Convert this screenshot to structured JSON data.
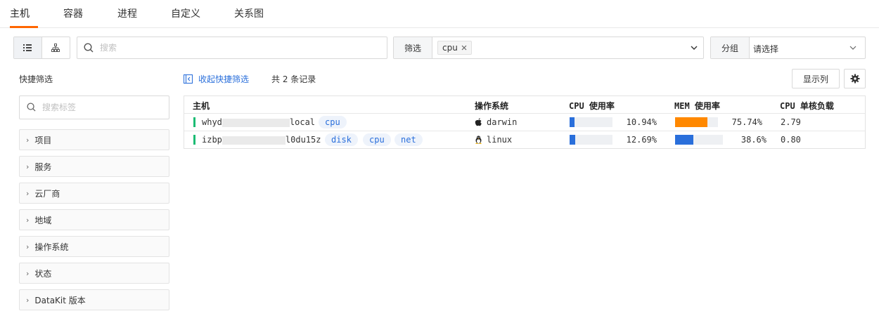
{
  "tabs": [
    {
      "label": "主机",
      "active": true
    },
    {
      "label": "容器"
    },
    {
      "label": "进程"
    },
    {
      "label": "自定义"
    },
    {
      "label": "关系图"
    }
  ],
  "toolbar": {
    "view_modes": [
      {
        "icon": "list-icon",
        "active": true
      },
      {
        "icon": "topology-icon"
      }
    ],
    "search": {
      "placeholder": "搜索",
      "value": ""
    },
    "filter": {
      "label": "筛选",
      "tags": [
        "cpu"
      ]
    },
    "group": {
      "label": "分组",
      "value": "请选择"
    }
  },
  "quick_filter": {
    "title": "快捷筛选",
    "search_placeholder": "搜索标签",
    "items": [
      "项目",
      "服务",
      "云厂商",
      "地域",
      "操作系统",
      "状态",
      "DataKit 版本"
    ]
  },
  "main": {
    "collapse_label": "收起快捷筛选",
    "record_count": "共 2 条记录",
    "columns_button": "显示列",
    "columns": [
      "主机",
      "操作系统",
      "CPU 使用率",
      "MEM 使用率",
      "CPU 单核负载"
    ],
    "rows": [
      {
        "host_prefix": "whyd",
        "host_suffix": "local",
        "tags": [
          "cpu"
        ],
        "os": "darwin",
        "os_icon": "apple-icon",
        "cpu": "10.94%",
        "cpu_value": 10.94,
        "mem": "75.74%",
        "mem_value": 75.74,
        "mem_color": "#ff8800",
        "load": "2.79"
      },
      {
        "host_prefix": "izbp",
        "host_suffix": "l0du15z",
        "tags": [
          "disk",
          "cpu",
          "net"
        ],
        "os": "linux",
        "os_icon": "linux-penguin-icon",
        "cpu": "12.69%",
        "cpu_value": 12.69,
        "mem": "38.6%",
        "mem_value": 38.6,
        "mem_color": "#2a6fdb",
        "load": "0.80"
      }
    ]
  },
  "colors": {
    "accent": "#ff6600",
    "link": "#2a6fdb",
    "status_ok": "#1bbc74",
    "cpu_bar": "#2a6fdb"
  }
}
